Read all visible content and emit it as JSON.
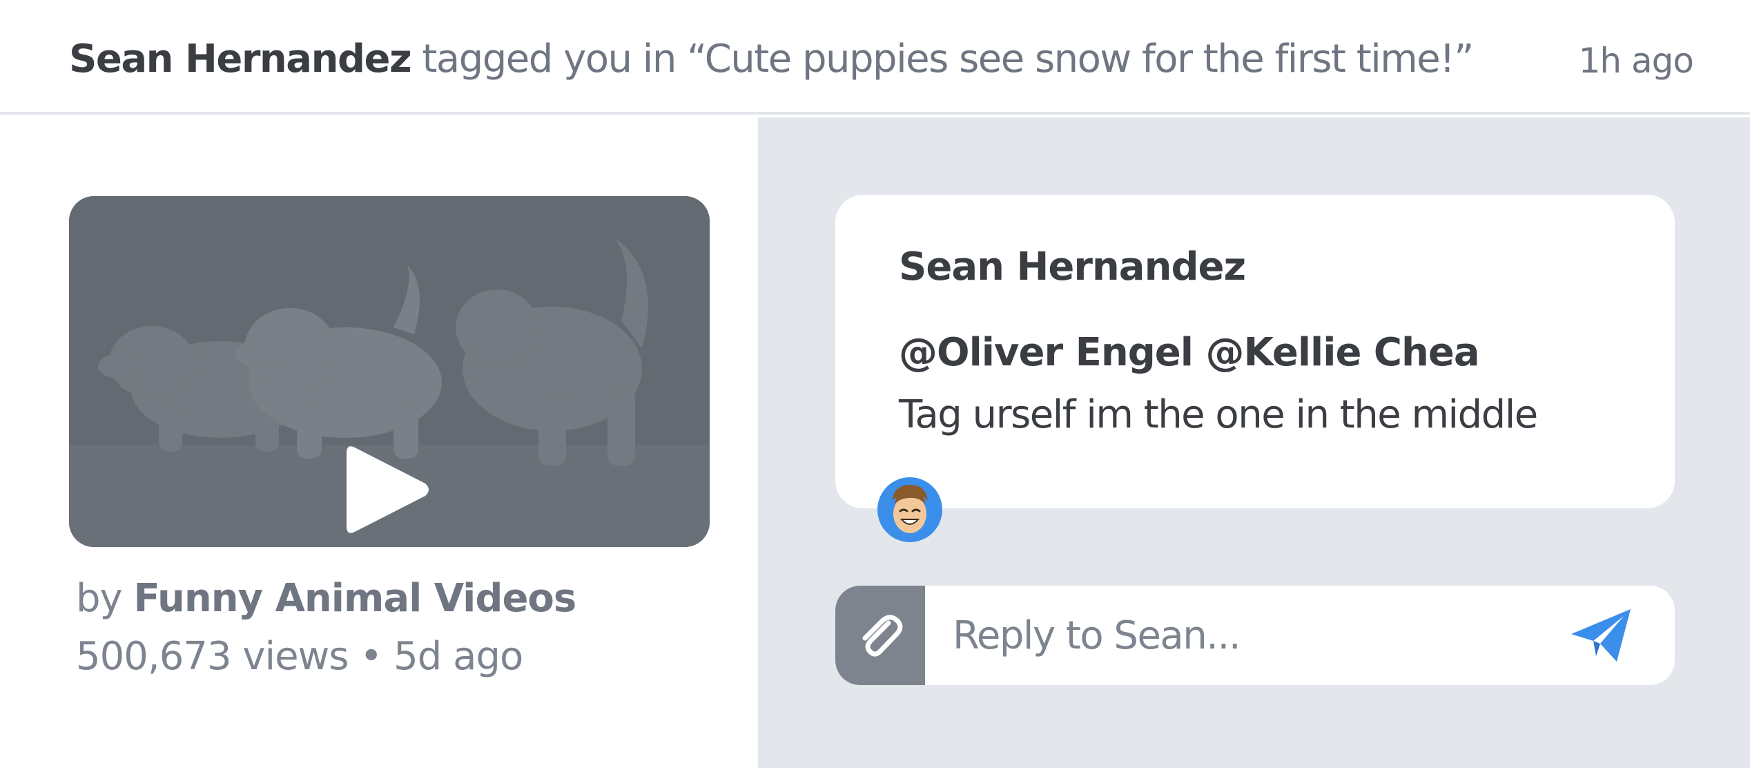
{
  "notification": {
    "actor": "Sean Hernandez",
    "action_prefix": "tagged you in “Cute puppies see snow for the first time!”",
    "time": "1h ago"
  },
  "video": {
    "by_prefix": "by",
    "channel": "Funny Animal Videos",
    "stats": "500,673 views • 5d ago",
    "play_icon": "play-icon"
  },
  "comment": {
    "author": "Sean Hernandez",
    "mentions": "@Oliver Engel @Kellie Chea",
    "body": "Tag urself im the one in the middle",
    "avatar_icon": "avatar"
  },
  "reply": {
    "placeholder": "Reply to Sean...",
    "attach_icon": "paperclip-icon",
    "send_icon": "send-icon"
  },
  "colors": {
    "accent": "#3b8eea",
    "panel_bg": "#e3e6eb",
    "text_dark": "#3a3d42",
    "text_muted": "#7d848f"
  }
}
